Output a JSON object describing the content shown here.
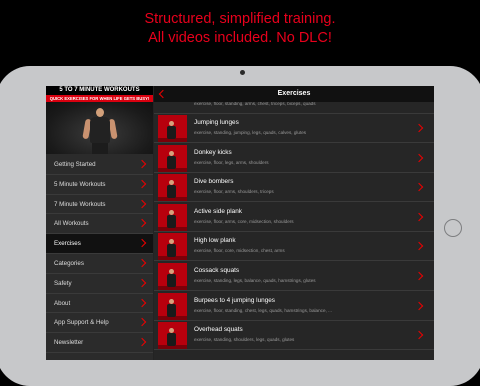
{
  "promo": {
    "line1": "Structured, simplified training.",
    "line2": "All videos included. No DLC!"
  },
  "sidebar": {
    "title": "5 TO 7 MINUTE WORKOUTS",
    "subtitle": "QUICK EXERCISES FOR WHEN LIFE GETS BUSY!",
    "items": [
      {
        "label": "Getting Started"
      },
      {
        "label": "5 Minute Workouts"
      },
      {
        "label": "7 Minute Workouts"
      },
      {
        "label": "All Workouts"
      },
      {
        "label": "Exercises",
        "active": true
      },
      {
        "label": "Categories"
      },
      {
        "label": "Safety"
      },
      {
        "label": "About"
      },
      {
        "label": "App Support & Help"
      },
      {
        "label": "Newsletter"
      }
    ]
  },
  "main": {
    "title": "Exercises",
    "top_tags": "exercise, floor, standing, arms, chest, triceps, biceps, quads",
    "rows": [
      {
        "name": "Jumping lunges",
        "tags": "exercise, standing, jumping, legs, quads, calves, glutes"
      },
      {
        "name": "Donkey kicks",
        "tags": "exercise, floor, legs, arms, shoulders"
      },
      {
        "name": "Dive bombers",
        "tags": "exercise, floor, arms, shoulders, triceps"
      },
      {
        "name": "Active side plank",
        "tags": "exercise, floor, arms, core, midsection, shoulders"
      },
      {
        "name": "High low plank",
        "tags": "exercise, floor, core, midsection, chest, arms"
      },
      {
        "name": "Cossack squats",
        "tags": "exercise, standing, legs, balance, quads, hamstrings, glutes"
      },
      {
        "name": "Burpees to 4 jumping lunges",
        "tags": "exercise, floor, standing, chest, legs, quads, hamstrings, balance, ..."
      },
      {
        "name": "Overhead squats",
        "tags": "exercise, standing, shoulders, legs, quads, glutes"
      }
    ]
  }
}
